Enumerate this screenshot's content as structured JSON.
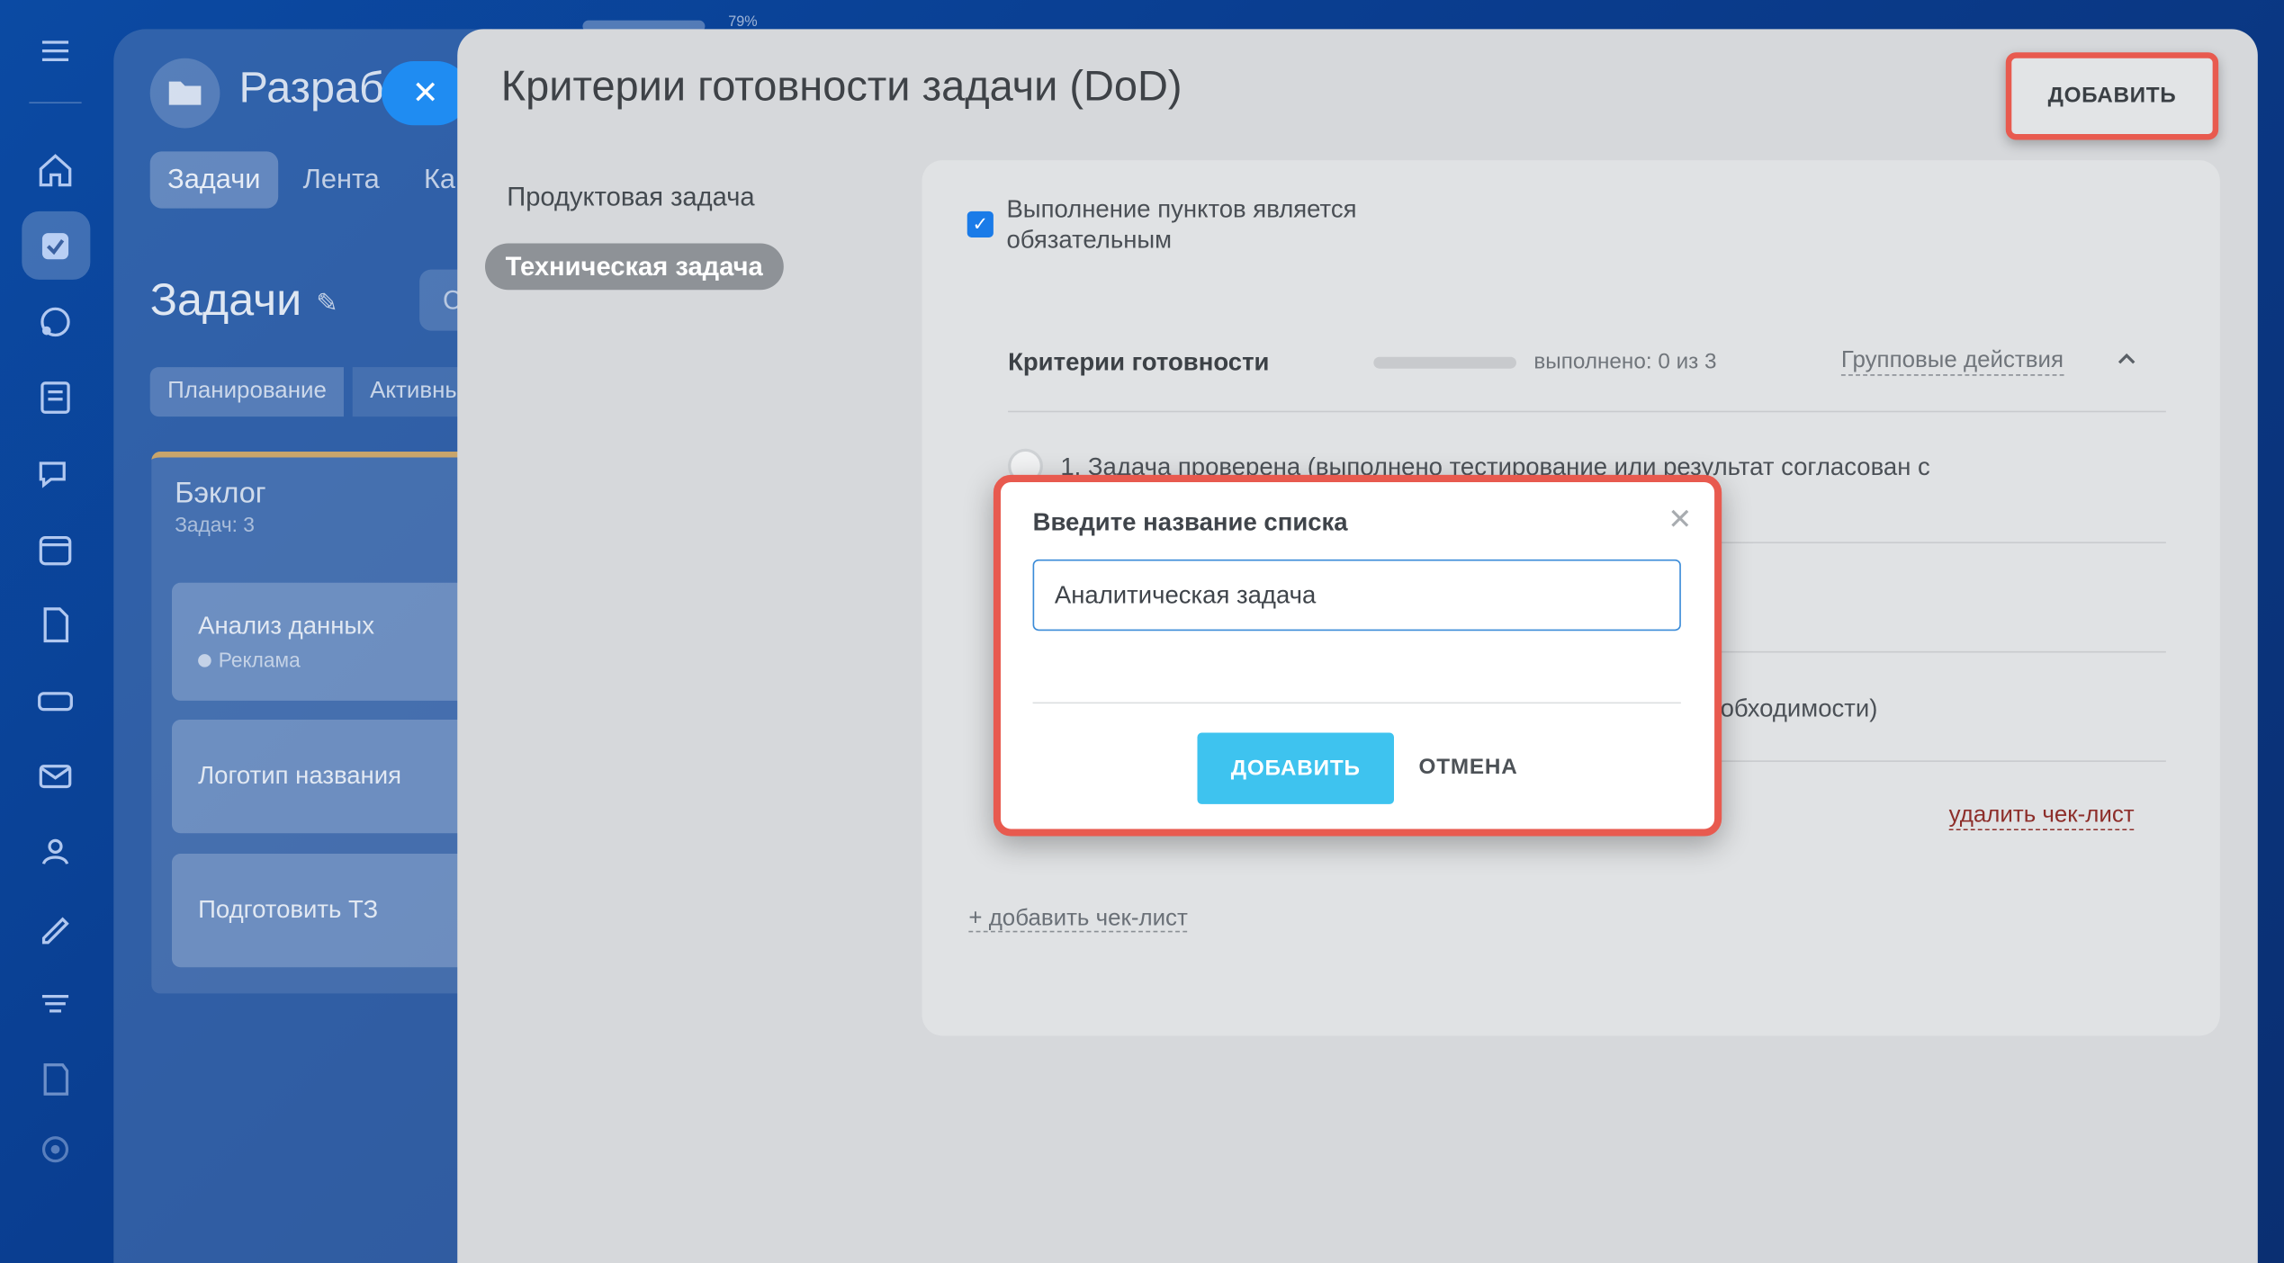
{
  "background": {
    "top_percent": "79%",
    "workspace_title": "Разраб",
    "tabs": [
      "Задачи",
      "Лента",
      "Ка"
    ],
    "page_title": "Задачи",
    "search_stub": "С",
    "segments": [
      "Планирование",
      "Активны"
    ],
    "column_title": "Бэклог",
    "column_sub": "Задач: 3",
    "cards": [
      {
        "title": "Анализ данных",
        "tag": "Реклама"
      },
      {
        "title": "Логотип названия",
        "tag": ""
      },
      {
        "title": "Подготовить ТЗ",
        "tag": ""
      }
    ]
  },
  "panel": {
    "title": "Критерии готовности задачи (DoD)",
    "add_button": "ДОБАВИТЬ",
    "nav": [
      "Продуктовая задача",
      "Техническая задача"
    ],
    "mandatory_label": "Выполнение пунктов является обязательным",
    "mandatory_checked": true,
    "checklist": {
      "title": "Критерии готовности",
      "progress": 0,
      "done_text": "выполнено: 0 из 3",
      "group_actions": "Групповые действия",
      "item1": "1. Задача проверена (выполнено тестирование или результат согласован с",
      "item3_tail": "обходимости)",
      "delete_link": "удалить чек-лист"
    },
    "add_checklist": "+ добавить чек-лист"
  },
  "modal": {
    "title": "Введите название списка",
    "input_value": "Аналитическая задача",
    "confirm": "ДОБАВИТЬ",
    "cancel": "ОТМЕНА"
  },
  "colors": {
    "accent": "#3ec3ef",
    "highlight": "#e85a4f",
    "checkbox": "#1a7be8"
  }
}
